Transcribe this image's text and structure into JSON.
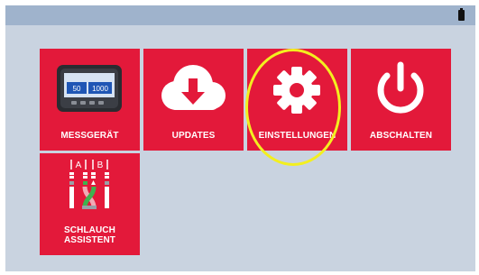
{
  "tiles": [
    {
      "label": "MESSGERÄT",
      "icon": "device-display-icon",
      "display_values": [
        "50",
        "1000"
      ]
    },
    {
      "label": "UPDATES",
      "icon": "cloud-download-icon"
    },
    {
      "label": "EINSTELLUNGEN",
      "icon": "gear-icon"
    },
    {
      "label": "ABSCHALTEN",
      "icon": "power-icon"
    },
    {
      "label_line1": "SCHLAUCH",
      "label_line2": "ASSISTENT",
      "icon": "hose-assistant-icon",
      "icon_letters": [
        "A",
        "B"
      ]
    }
  ],
  "colors": {
    "tile": "#e3193a",
    "background": "#c9d3e0",
    "topbar": "#9fb3cc",
    "highlight": "#f3ef1f"
  }
}
